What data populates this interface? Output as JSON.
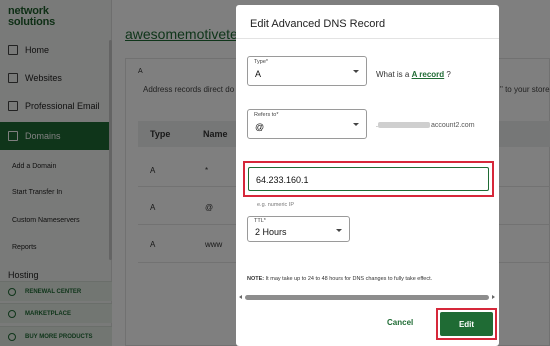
{
  "sidebar": {
    "logo_line1": "network",
    "logo_line2": "solutions",
    "items": [
      {
        "label": "Home",
        "icon": "gear-icon"
      },
      {
        "label": "Websites",
        "icon": "grid-icon"
      },
      {
        "label": "Professional Email",
        "icon": "mail-icon"
      },
      {
        "label": "Domains",
        "icon": "globe-icon"
      }
    ],
    "sub_items": [
      "Add a Domain",
      "Start Transfer In",
      "Custom Nameservers",
      "Reports",
      "Hosting"
    ],
    "promos": [
      {
        "label": "RENEWAL CENTER",
        "icon": "refresh-icon"
      },
      {
        "label": "MARKETPLACE",
        "icon": "store-icon"
      },
      {
        "label": "BUY MORE PRODUCTS",
        "icon": "cart-icon"
      }
    ]
  },
  "main": {
    "domain_title": "awesomemotivete...",
    "record_label": "A",
    "desc_left": "Address records direct do",
    "desc_right": "\" to your store",
    "columns": [
      "Type",
      "Name"
    ],
    "rows": [
      {
        "type": "A",
        "name": "*"
      },
      {
        "type": "A",
        "name": "@"
      },
      {
        "type": "A",
        "name": "www"
      }
    ]
  },
  "modal": {
    "title": "Edit Advanced DNS Record",
    "type_label": "Type*",
    "type_value": "A",
    "what_is_prefix": "What is a",
    "what_is_link": "A record",
    "what_is_suffix": "?",
    "refers_label": "Refers to*",
    "refers_value": "@",
    "refers_suffix": "account2.com",
    "ip_value": "64.233.160.1",
    "ip_hint": "e.g. numeric IP",
    "ttl_label": "TTL*",
    "ttl_value": "2 Hours",
    "note_bold": "NOTE:",
    "note_text": " It may take up to 24 to 48 hours for DNS changes to fully take effect.",
    "cancel_label": "Cancel",
    "edit_label": "Edit"
  },
  "colors": {
    "brand": "#1f6b34",
    "highlight": "#d6283a"
  }
}
